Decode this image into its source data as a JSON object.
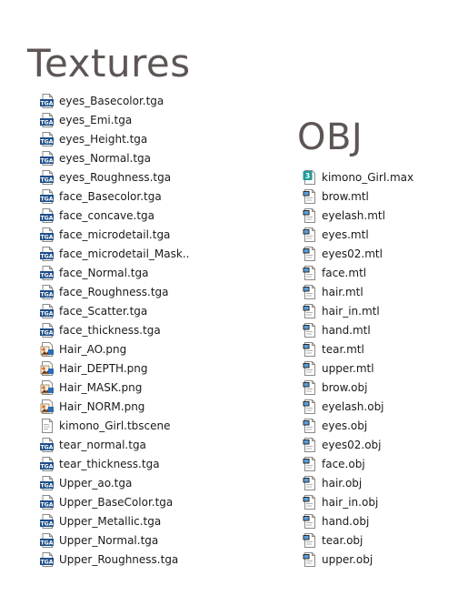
{
  "textures": {
    "heading": "Textures",
    "files": [
      {
        "name": "eyes_Basecolor.tga",
        "icon": "tga-file-icon"
      },
      {
        "name": "eyes_Emi.tga",
        "icon": "tga-file-icon"
      },
      {
        "name": "eyes_Height.tga",
        "icon": "tga-file-icon"
      },
      {
        "name": "eyes_Normal.tga",
        "icon": "tga-file-icon"
      },
      {
        "name": "eyes_Roughness.tga",
        "icon": "tga-file-icon"
      },
      {
        "name": "face_Basecolor.tga",
        "icon": "tga-file-icon"
      },
      {
        "name": "face_concave.tga",
        "icon": "tga-file-icon"
      },
      {
        "name": "face_microdetail.tga",
        "icon": "tga-file-icon"
      },
      {
        "name": "face_microdetail_Mask..",
        "icon": "tga-file-icon"
      },
      {
        "name": "face_Normal.tga",
        "icon": "tga-file-icon"
      },
      {
        "name": "face_Roughness.tga",
        "icon": "tga-file-icon"
      },
      {
        "name": "face_Scatter.tga",
        "icon": "tga-file-icon"
      },
      {
        "name": "face_thickness.tga",
        "icon": "tga-file-icon"
      },
      {
        "name": "Hair_AO.png",
        "icon": "png-file-icon"
      },
      {
        "name": "Hair_DEPTH.png",
        "icon": "png-file-icon"
      },
      {
        "name": "Hair_MASK.png",
        "icon": "png-file-icon"
      },
      {
        "name": "Hair_NORM.png",
        "icon": "png-file-icon"
      },
      {
        "name": "kimono_Girl.tbscene",
        "icon": "generic-file-icon"
      },
      {
        "name": "tear_normal.tga",
        "icon": "tga-file-icon"
      },
      {
        "name": "tear_thickness.tga",
        "icon": "tga-file-icon"
      },
      {
        "name": "Upper_ao.tga",
        "icon": "tga-file-icon"
      },
      {
        "name": "Upper_BaseColor.tga",
        "icon": "tga-file-icon"
      },
      {
        "name": "Upper_Metallic.tga",
        "icon": "tga-file-icon"
      },
      {
        "name": "Upper_Normal.tga",
        "icon": "tga-file-icon"
      },
      {
        "name": "Upper_Roughness.tga",
        "icon": "tga-file-icon"
      }
    ]
  },
  "obj": {
    "heading": "OBJ",
    "files": [
      {
        "name": "kimono_Girl.max",
        "icon": "max-file-icon"
      },
      {
        "name": "brow.mtl",
        "icon": "mtl-file-icon"
      },
      {
        "name": "eyelash.mtl",
        "icon": "mtl-file-icon"
      },
      {
        "name": "eyes.mtl",
        "icon": "mtl-file-icon"
      },
      {
        "name": "eyes02.mtl",
        "icon": "mtl-file-icon"
      },
      {
        "name": "face.mtl",
        "icon": "mtl-file-icon"
      },
      {
        "name": "hair.mtl",
        "icon": "mtl-file-icon"
      },
      {
        "name": "hair_in.mtl",
        "icon": "mtl-file-icon"
      },
      {
        "name": "hand.mtl",
        "icon": "mtl-file-icon"
      },
      {
        "name": "tear.mtl",
        "icon": "mtl-file-icon"
      },
      {
        "name": "upper.mtl",
        "icon": "mtl-file-icon"
      },
      {
        "name": "brow.obj",
        "icon": "obj-file-icon"
      },
      {
        "name": "eyelash.obj",
        "icon": "obj-file-icon"
      },
      {
        "name": "eyes.obj",
        "icon": "obj-file-icon"
      },
      {
        "name": "eyes02.obj",
        "icon": "obj-file-icon"
      },
      {
        "name": "face.obj",
        "icon": "obj-file-icon"
      },
      {
        "name": "hair.obj",
        "icon": "obj-file-icon"
      },
      {
        "name": "hair_in.obj",
        "icon": "obj-file-icon"
      },
      {
        "name": "hand.obj",
        "icon": "obj-file-icon"
      },
      {
        "name": "tear.obj",
        "icon": "obj-file-icon"
      },
      {
        "name": "upper.obj",
        "icon": "obj-file-icon"
      }
    ]
  },
  "colors": {
    "heading": "#5e5555",
    "text": "#1a1a1a",
    "tga_badge": "#1e4f8a",
    "png_accent": "#e07020",
    "max_teal": "#1f9a9a"
  }
}
